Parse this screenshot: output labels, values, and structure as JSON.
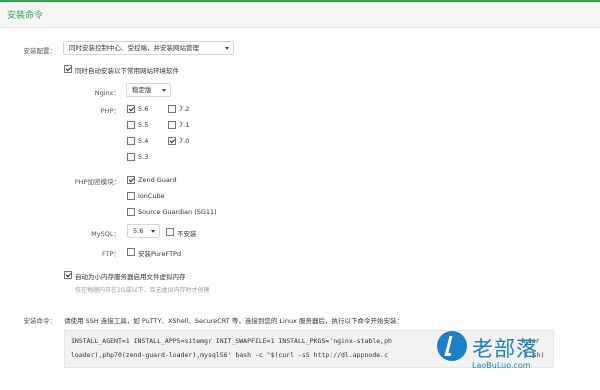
{
  "panel": {
    "title": "安装命令"
  },
  "config": {
    "label": "安装配置：",
    "mode_select": "同时安装控制中心、受控端，并安装网站管理",
    "auto_install_label": "同时自动安装以下常用网站环境软件",
    "nginx": {
      "label": "Nginx：",
      "value": "稳定版"
    },
    "php": {
      "label": "PHP：",
      "options": [
        {
          "label": "5.6",
          "checked": true
        },
        {
          "label": "7.2",
          "checked": false
        },
        {
          "label": "5.5",
          "checked": false
        },
        {
          "label": "7.1",
          "checked": false
        },
        {
          "label": "5.4",
          "checked": false
        },
        {
          "label": "7.0",
          "checked": true
        },
        {
          "label": "5.3",
          "checked": false
        }
      ]
    },
    "php_encrypt": {
      "label": "PHP加密模块：",
      "options": [
        {
          "label": "Zend Guard",
          "checked": true
        },
        {
          "label": "ionCube",
          "checked": false
        },
        {
          "label": "Source Guardian (SG11)",
          "checked": false
        }
      ]
    },
    "mysql": {
      "label": "MySQL：",
      "value": "5.6",
      "no_install_label": "不安装",
      "no_install_checked": false
    },
    "ftp": {
      "label": "FTP：",
      "option_label": "安装PureFTPd",
      "checked": false
    },
    "swap": {
      "label": "自动为小内存服务器启用文件虚拟内存",
      "checked": true,
      "hint": "仅在物理内存在2G或以下，且无虚拟内存时才创建"
    }
  },
  "command": {
    "label": "安装命令：",
    "instruction": "请使用 SSH 连接工具，如 PuTTY、XShell、SecureCRT 等，连接到您的 Linux 服务器后，执行以下命令开始安装：",
    "line1": "INSTALL_AGENT=1 INSTALL_APPS=sitemgr INIT_SWAPFILE=1 INSTALL_PKGS='nginx-stable,ph",
    "line1_tail": "-guar",
    "line2": "loader),php70(zend-guard-loader),mysql56' bash -c \"$(curl -sS http://dl.appnode.c",
    "line2_tail": "l.sh)"
  },
  "watermark": {
    "cn": "老部落",
    "en": "LaoBuLuo.com",
    "color": "#1d7fc5"
  },
  "colors": {
    "accent": "#35a34b"
  }
}
